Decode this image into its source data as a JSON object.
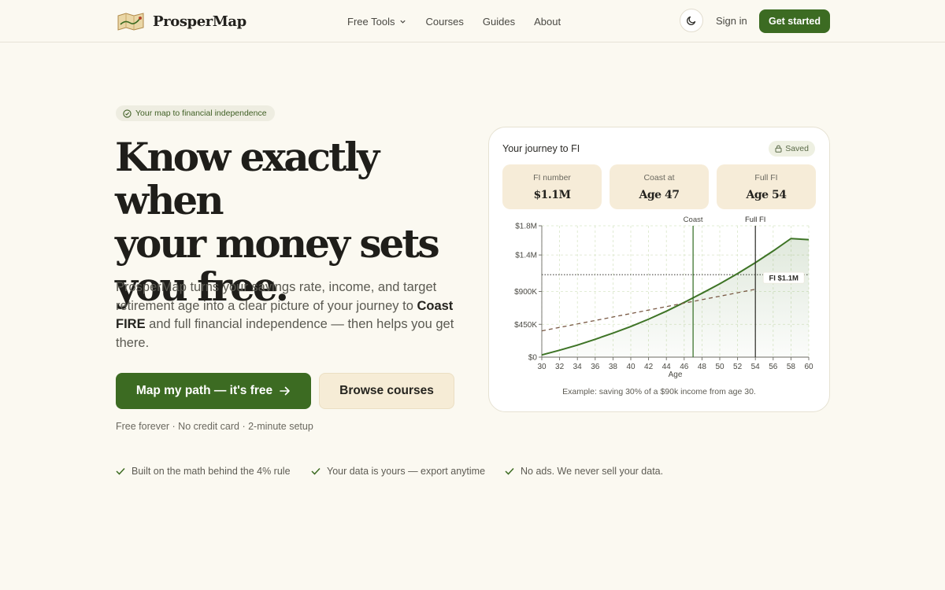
{
  "brand": {
    "name": "ProsperMap",
    "logo_icon": "map-scroll-icon"
  },
  "nav": {
    "links": [
      "Free Tools",
      "Courses",
      "Guides",
      "About"
    ],
    "theme_icon": "moon-icon",
    "signin_label": "Sign in",
    "cta_label": "Get started"
  },
  "hero": {
    "badge": "Your map to financial independence",
    "headline_lines": [
      "Know exactly when",
      "your money sets",
      "you free."
    ],
    "lead_before": "ProsperMap turns your savings rate, income, and target retirement age into a clear picture of your journey to ",
    "lead_emphasis": "Coast FIRE",
    "lead_after": " and full financial independence — then helps you get there.",
    "primary_button": "Map my path — it's free",
    "secondary_button": "Browse courses",
    "fine_print": "Free forever · No credit card · 2-minute setup"
  },
  "trust_items": [
    "Built on the math behind the 4% rule",
    "Your data is yours — export anytime",
    "No ads. We never sell your data."
  ],
  "card": {
    "title": "Your journey to FI",
    "saved_label": "Saved",
    "stats": [
      {
        "label": "FI number",
        "value": "$1.1M"
      },
      {
        "label": "Coast at",
        "value": "Age 47"
      },
      {
        "label": "Full FI",
        "value": "Age 54"
      }
    ],
    "note": "Example: saving 30% of a $90k income from age 30."
  },
  "colors": {
    "accent": "#3c6b22",
    "curve": "#3e7426",
    "coast_line": "#2f6a1e",
    "full_fi_line": "#2b2a26",
    "coast_target": "#7a5a45",
    "fi_threshold": "#4a4943",
    "background": "#fbf9f1",
    "stat_card": "#f6ecd8"
  },
  "chart_data": {
    "type": "line",
    "xlabel": "Age",
    "ylabel": "",
    "xlim": [
      30,
      60
    ],
    "ylim": [
      0,
      1800000
    ],
    "x_ticks": [
      30,
      32,
      34,
      36,
      38,
      40,
      42,
      44,
      46,
      48,
      50,
      52,
      54,
      56,
      58,
      60
    ],
    "y_ticks": [
      0,
      450000,
      900000,
      1400000,
      1800000
    ],
    "y_tick_labels": [
      "$0",
      "$450K",
      "$900K",
      "$1.4M",
      "$1.8M"
    ],
    "series": [
      {
        "x": [
          30,
          32,
          34,
          36,
          38,
          40,
          42,
          44,
          46,
          48,
          50,
          52,
          54,
          56,
          58,
          60
        ],
        "values": [
          30000,
          95000,
          165000,
          245000,
          330000,
          420000,
          520000,
          630000,
          750000,
          875000,
          1005000,
          1145000,
          1295000,
          1455000,
          1625000,
          1610000
        ]
      },
      {
        "x": [
          30,
          54
        ],
        "values": [
          360000,
          930000
        ]
      }
    ],
    "annotations": [
      {
        "label": "Coast",
        "x": 47
      },
      {
        "label": "Full FI",
        "x": 54
      },
      {
        "label": "FI $1.1M",
        "y": 1130000
      }
    ],
    "grid": true,
    "legend": "none"
  }
}
